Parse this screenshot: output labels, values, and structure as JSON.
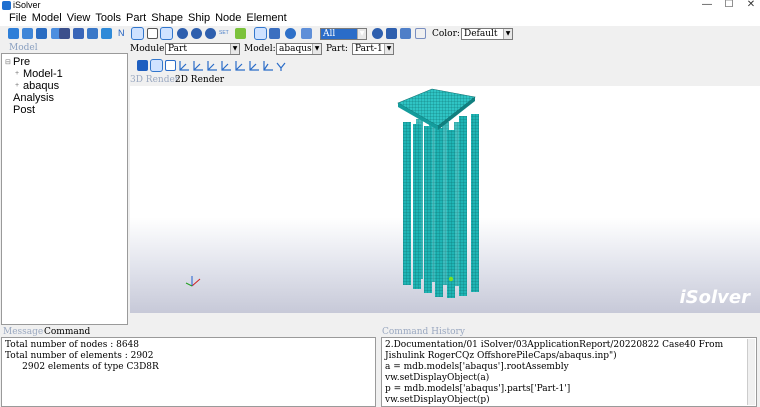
{
  "window": {
    "title": "iSolver",
    "min": "—",
    "max": "☐",
    "close": "✕"
  },
  "menu": [
    "File",
    "Model",
    "View",
    "Tools",
    "Part",
    "Shape",
    "Ship",
    "Node",
    "Element"
  ],
  "toolbar": {
    "display_select_value": "All",
    "color_label": "Color:",
    "color_value": "Default"
  },
  "context": {
    "module_label": "Module:",
    "module_value": "Part",
    "model_label": "Model:",
    "model_value": "abaqus",
    "part_label": "Part:",
    "part_value": "Part-1"
  },
  "model_panel": {
    "title": "Model",
    "tree": [
      {
        "label": "Pre",
        "level": 0,
        "expander": "⊟"
      },
      {
        "label": "Model-1",
        "level": 1,
        "expander": "+"
      },
      {
        "label": "abaqus",
        "level": 1,
        "expander": "+"
      },
      {
        "label": "Analysis",
        "level": 0,
        "expander": ""
      },
      {
        "label": "Post",
        "level": 0,
        "expander": ""
      }
    ]
  },
  "render_tabs": {
    "tab_3d": "3D Render",
    "tab_2d": "2D Render",
    "active": "2D Render"
  },
  "viewport": {
    "watermark": "iSolver",
    "model_color": "#1fb5b5",
    "background_bottom": "#c7c9d8"
  },
  "message_panel": {
    "tab_message": "Message",
    "tab_command": "Command",
    "lines": [
      "Total number of nodes : 8648",
      "Total number of elements : 2902",
      "      2902 elements of type C3D8R"
    ]
  },
  "history_panel": {
    "title": "Command History",
    "lines": [
      "2.Documentation/01 iSolver/03ApplicationReport/20220822 Case40 From",
      "Jishulink RogerCQz OffshorePileCaps/abaqus.inp\")",
      "a = mdb.models['abaqus'].rootAssembly",
      "vw.setDisplayObject(a)",
      "p = mdb.models['abaqus'].parts['Part-1']",
      "vw.setDisplayObject(p)"
    ]
  }
}
